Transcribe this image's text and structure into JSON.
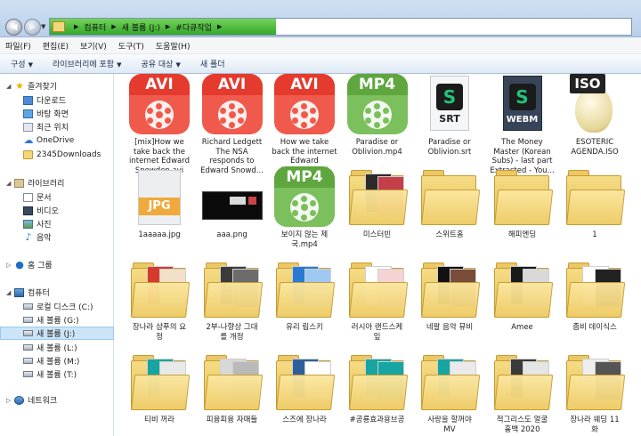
{
  "address": {
    "crumbs": [
      "컴퓨터",
      "새 볼륨 (J:)",
      "#다큐작업"
    ]
  },
  "menu": [
    "파일(F)",
    "편집(E)",
    "보기(V)",
    "도구(T)",
    "도움말(H)"
  ],
  "toolbar": {
    "organize": "구성",
    "include_library": "라이브러리에 포함",
    "share": "공유 대상",
    "new_folder": "새 폴더"
  },
  "nav": {
    "favorites": "즐겨찾기",
    "downloads": "다운로드",
    "desktop": "바탕 화면",
    "recent": "최근 위치",
    "onedrive": "OneDrive",
    "downloads2345": "2345Downloads",
    "libraries": "라이브러리",
    "documents": "문서",
    "videos": "비디오",
    "pictures": "사진",
    "music": "음악",
    "homegroup": "홈 그룹",
    "computer": "컴퓨터",
    "drive_c": "로컬 디스크 (C:)",
    "drive_g": "새 볼륨 (G:)",
    "drive_j": "새 볼륨 (J:)",
    "drive_l": "새 볼륨 (L:)",
    "drive_m": "새 볼륨 (M:)",
    "drive_t": "새 볼륨 (T:)",
    "network": "네트워크"
  },
  "files": [
    {
      "name": "[mix]How we take back the internet Edward Snowden.avi",
      "label": "[mix]How we\ntake back the\ninternet    Edward\nSnowden.avi",
      "kind": "app-red",
      "badge": "AVI"
    },
    {
      "name": "Richard Ledgett The NSA responds to Edward Snowden",
      "label": "Richard Ledgett\nThe NSA\nresponds to\nEdward Snowd...",
      "kind": "app-red",
      "badge": "AVI"
    },
    {
      "name": "How we take back the internet Edward Snowden.avi",
      "label": "How we take\nback the internet\nEdward\nSnowden.avi",
      "kind": "app-red",
      "badge": "AVI"
    },
    {
      "name": "Paradise or Oblivion.mp4",
      "label": "Paradise or\nOblivion.mp4",
      "kind": "app-green",
      "badge": "MP4"
    },
    {
      "name": "Paradise or Oblivion.srt",
      "label": "Paradise or\nOblivion.srt",
      "kind": "srt",
      "badge": "S",
      "ext": "SRT"
    },
    {
      "name": "The Money Master (Korean Subs) - last part Extracted",
      "label": "The Money\nMaster (Korean\nSubs) - last part\nExtracted - You...",
      "kind": "webm",
      "badge": "S",
      "ext": "WEBM"
    },
    {
      "name": "ESOTERIC AGENDA.ISO",
      "label": "ESOTERIC\nAGENDA.ISO",
      "kind": "iso",
      "badge": "ISO"
    },
    {
      "name": "1aaaaa.jpg",
      "label": "1aaaaa.jpg",
      "kind": "jpg",
      "badge": "JPG"
    },
    {
      "name": "aaa.png",
      "label": "aaa.png",
      "kind": "png"
    },
    {
      "name": "보이지 않는 제국.mp4",
      "label": "보이지 않는 제\n국.mp4",
      "kind": "app-green",
      "badge": "MP4"
    },
    {
      "name": "미스터빈",
      "label": "미스터빈",
      "kind": "folder",
      "paper": [
        "#2b2b2b",
        "#c43f4a"
      ]
    },
    {
      "name": "스위트홈",
      "label": "스위트홈",
      "kind": "folder",
      "paper": []
    },
    {
      "name": "해피엔딩",
      "label": "해피엔딩",
      "kind": "folder",
      "paper": []
    },
    {
      "name": "1",
      "label": "1",
      "kind": "folder",
      "paper": []
    },
    {
      "name": "장나라 샴푸의 요정",
      "label": "장나라 샴푸의 요\n정",
      "kind": "folder",
      "paper": [
        "#d53a2c",
        "#f2e1c8"
      ]
    },
    {
      "name": "2부-나향상 그대를 개정",
      "label": "2부-나향상 그대\n를 개정",
      "kind": "folder",
      "paper": [
        "#3b3b3b",
        "#6c6c6c"
      ]
    },
    {
      "name": "유리 립스키",
      "label": "유리 립스키",
      "kind": "folder",
      "paper": [
        "#2a7ad3",
        "#9ec9f2"
      ]
    },
    {
      "name": "러시아 랜드스케잎",
      "label": "러시아 랜드스케\n잎",
      "kind": "folder",
      "paper": [
        "#ffffff",
        "#f6d3d3"
      ]
    },
    {
      "name": "네팔 음악 뮤비",
      "label": "네팔 음악 뮤비",
      "kind": "folder",
      "paper": [
        "#111111",
        "#7a4c3a"
      ]
    },
    {
      "name": "Amee",
      "label": "Amee",
      "kind": "folder",
      "paper": [
        "#1a1a1a",
        "#d9d9d9"
      ]
    },
    {
      "name": "좀비 데이식스",
      "label": "좀비 데이식스",
      "kind": "folder",
      "paper": [
        "#ffffff",
        "#222222"
      ]
    },
    {
      "name": "티비 꺼라",
      "label": "티비 꺼라",
      "kind": "folder",
      "paper": [
        "#16a5a0",
        "#e9e9e9"
      ]
    },
    {
      "name": "피융피융 자매들",
      "label": "피융피융 자매들",
      "kind": "folder",
      "paper": [
        "#d8d8d8",
        "#b9b9b9"
      ]
    },
    {
      "name": "스즈에 장나라",
      "label": "스즈에 장나라",
      "kind": "folder",
      "paper": [
        "#2f5f9a",
        "#ffffff"
      ]
    },
    {
      "name": "#공룡효과용브공",
      "label": "#공룡효과용브공",
      "kind": "folder",
      "paper": [
        "#16a5a0",
        "#16a5a0"
      ]
    },
    {
      "name": "사랑을 할꺼야 MV",
      "label": "사랑을 할꺼야\nMV",
      "kind": "folder",
      "paper": [
        "#16a5a0",
        "#eaeaea"
      ]
    },
    {
      "name": "적그리스도 얼굴 흉백 2020",
      "label": "적그리스도 얼굴\n흉백 2020",
      "kind": "folder",
      "paper": [
        "#3a3a3a",
        "#e5e5e5"
      ]
    },
    {
      "name": "장나라 웨딩 11화",
      "label": "장나라 웨딩 11\n화",
      "kind": "folder",
      "paper": [
        "#eeeeee",
        "#555555"
      ]
    }
  ],
  "colors": {
    "avi": "#e53a2e",
    "mp4": "#5ea63d",
    "selection": "#cce4f7",
    "folder": "#f5dc86"
  }
}
